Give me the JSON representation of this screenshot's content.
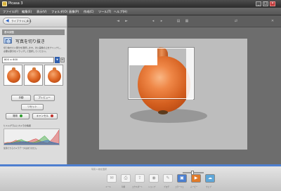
{
  "window": {
    "title": "Picasa 3",
    "min": "_",
    "max": "□",
    "close": "×"
  },
  "menu": [
    {
      "label": "ファイル(F)"
    },
    {
      "label": "編集(E)"
    },
    {
      "label": "表示(V)"
    },
    {
      "label": "フォルダ(O)"
    },
    {
      "label": "画像(P)"
    },
    {
      "label": "作成(C)"
    },
    {
      "label": "ツール(T)"
    },
    {
      "label": "ヘルプ(H)"
    }
  ],
  "toolbar": {
    "icons": [
      "◄",
      "►",
      "◂",
      "▸",
      "▤",
      "▦",
      "⇄",
      "✕"
    ]
  },
  "left_panel": {
    "back_label": "ライブラリに戻る",
    "tab_label": "基本調整",
    "tool_title": "写真を切り抜き",
    "tool_description": "切り抜きたい部分を選択します。次に画像の上をクリックし、必要な部分をドラッグして選択してください。",
    "ratio_value": "800 × 600",
    "ratio_arrow": "▼",
    "ratio_extra": "↔",
    "buttons": {
      "manual": "手動",
      "preview": "プレビュー",
      "reset": "リセット",
      "apply": "適用",
      "cancel": "キャンセル"
    },
    "histogram_label": "ヒストグラムとカメラの情報",
    "histogram_note": "使用できるカメラデータはありません"
  },
  "bottom_bar": {
    "status": "写真 1 枚を選択",
    "trays": [
      {
        "icon": "✉",
        "label": "メール"
      },
      {
        "icon": "⎙",
        "label": "印刷"
      },
      {
        "icon": "⇪",
        "label": "エクスポート"
      },
      {
        "icon": "◉",
        "label": "ショップ"
      },
      {
        "icon": "✎",
        "label": "ブログ"
      },
      {
        "icon": "▣",
        "label": "コラージュ"
      },
      {
        "icon": "▶",
        "label": "ムービー"
      },
      {
        "icon": "☁",
        "label": "ウェブ"
      }
    ]
  },
  "colors": {
    "accent_blue": "#2f5fae",
    "apply_green": "#2e9c2e",
    "cancel_red": "#c0302a",
    "onion": "#d45f1f"
  },
  "histogram": {
    "red": [
      2,
      3,
      3,
      4,
      6,
      5,
      4,
      3,
      4,
      5,
      7,
      8,
      6,
      4,
      3,
      2,
      5,
      9,
      14,
      20
    ],
    "green": [
      1,
      2,
      2,
      3,
      4,
      6,
      7,
      5,
      4,
      3,
      3,
      4,
      6,
      9,
      12,
      8,
      4,
      3,
      2,
      1
    ],
    "blue": [
      1,
      1,
      2,
      2,
      3,
      3,
      4,
      4,
      3,
      3,
      2,
      2,
      3,
      4,
      5,
      6,
      4,
      3,
      2,
      1
    ]
  }
}
